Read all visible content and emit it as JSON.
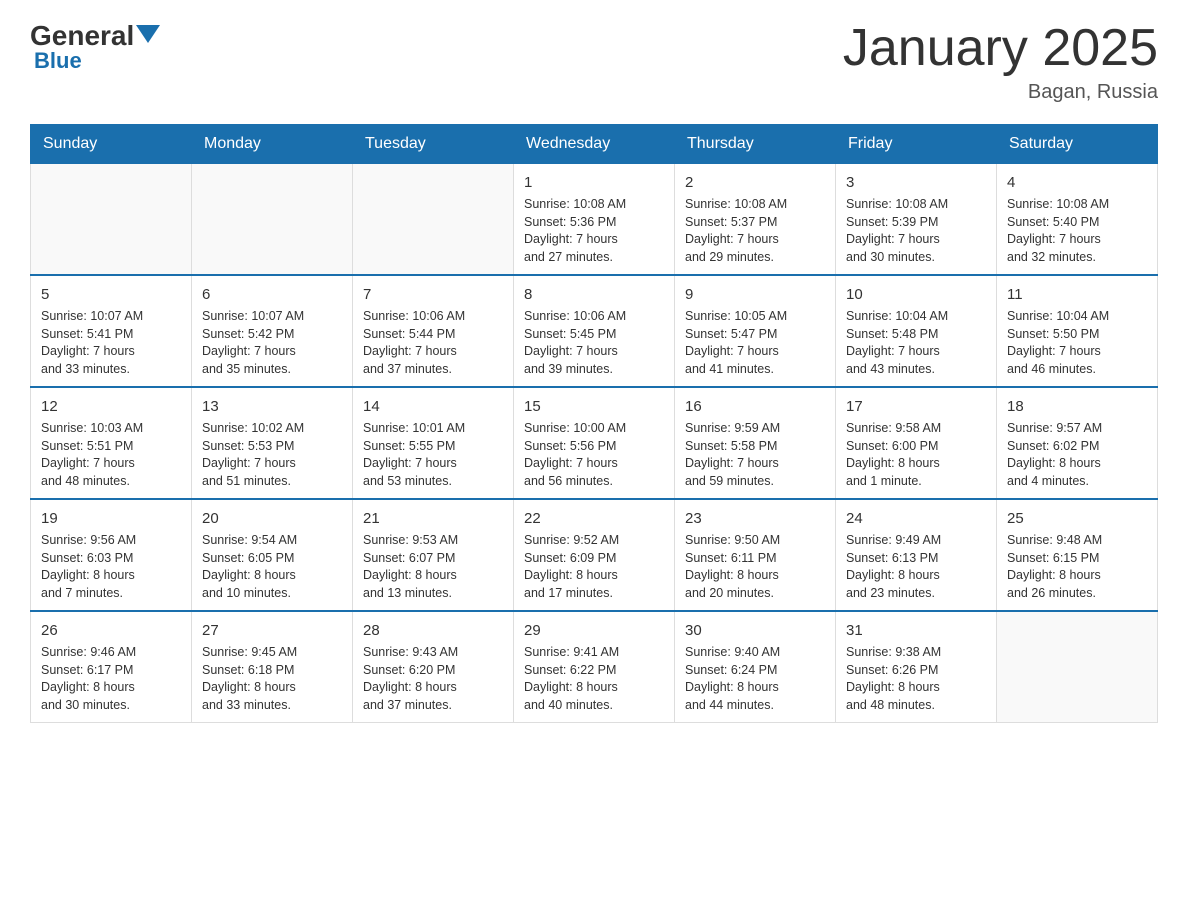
{
  "header": {
    "logo": {
      "general": "General",
      "blue": "Blue",
      "tagline": "Blue"
    },
    "title": "January 2025",
    "location": "Bagan, Russia"
  },
  "days_of_week": [
    "Sunday",
    "Monday",
    "Tuesday",
    "Wednesday",
    "Thursday",
    "Friday",
    "Saturday"
  ],
  "weeks": [
    [
      {
        "date": "",
        "info": ""
      },
      {
        "date": "",
        "info": ""
      },
      {
        "date": "",
        "info": ""
      },
      {
        "date": "1",
        "info": "Sunrise: 10:08 AM\nSunset: 5:36 PM\nDaylight: 7 hours\nand 27 minutes."
      },
      {
        "date": "2",
        "info": "Sunrise: 10:08 AM\nSunset: 5:37 PM\nDaylight: 7 hours\nand 29 minutes."
      },
      {
        "date": "3",
        "info": "Sunrise: 10:08 AM\nSunset: 5:39 PM\nDaylight: 7 hours\nand 30 minutes."
      },
      {
        "date": "4",
        "info": "Sunrise: 10:08 AM\nSunset: 5:40 PM\nDaylight: 7 hours\nand 32 minutes."
      }
    ],
    [
      {
        "date": "5",
        "info": "Sunrise: 10:07 AM\nSunset: 5:41 PM\nDaylight: 7 hours\nand 33 minutes."
      },
      {
        "date": "6",
        "info": "Sunrise: 10:07 AM\nSunset: 5:42 PM\nDaylight: 7 hours\nand 35 minutes."
      },
      {
        "date": "7",
        "info": "Sunrise: 10:06 AM\nSunset: 5:44 PM\nDaylight: 7 hours\nand 37 minutes."
      },
      {
        "date": "8",
        "info": "Sunrise: 10:06 AM\nSunset: 5:45 PM\nDaylight: 7 hours\nand 39 minutes."
      },
      {
        "date": "9",
        "info": "Sunrise: 10:05 AM\nSunset: 5:47 PM\nDaylight: 7 hours\nand 41 minutes."
      },
      {
        "date": "10",
        "info": "Sunrise: 10:04 AM\nSunset: 5:48 PM\nDaylight: 7 hours\nand 43 minutes."
      },
      {
        "date": "11",
        "info": "Sunrise: 10:04 AM\nSunset: 5:50 PM\nDaylight: 7 hours\nand 46 minutes."
      }
    ],
    [
      {
        "date": "12",
        "info": "Sunrise: 10:03 AM\nSunset: 5:51 PM\nDaylight: 7 hours\nand 48 minutes."
      },
      {
        "date": "13",
        "info": "Sunrise: 10:02 AM\nSunset: 5:53 PM\nDaylight: 7 hours\nand 51 minutes."
      },
      {
        "date": "14",
        "info": "Sunrise: 10:01 AM\nSunset: 5:55 PM\nDaylight: 7 hours\nand 53 minutes."
      },
      {
        "date": "15",
        "info": "Sunrise: 10:00 AM\nSunset: 5:56 PM\nDaylight: 7 hours\nand 56 minutes."
      },
      {
        "date": "16",
        "info": "Sunrise: 9:59 AM\nSunset: 5:58 PM\nDaylight: 7 hours\nand 59 minutes."
      },
      {
        "date": "17",
        "info": "Sunrise: 9:58 AM\nSunset: 6:00 PM\nDaylight: 8 hours\nand 1 minute."
      },
      {
        "date": "18",
        "info": "Sunrise: 9:57 AM\nSunset: 6:02 PM\nDaylight: 8 hours\nand 4 minutes."
      }
    ],
    [
      {
        "date": "19",
        "info": "Sunrise: 9:56 AM\nSunset: 6:03 PM\nDaylight: 8 hours\nand 7 minutes."
      },
      {
        "date": "20",
        "info": "Sunrise: 9:54 AM\nSunset: 6:05 PM\nDaylight: 8 hours\nand 10 minutes."
      },
      {
        "date": "21",
        "info": "Sunrise: 9:53 AM\nSunset: 6:07 PM\nDaylight: 8 hours\nand 13 minutes."
      },
      {
        "date": "22",
        "info": "Sunrise: 9:52 AM\nSunset: 6:09 PM\nDaylight: 8 hours\nand 17 minutes."
      },
      {
        "date": "23",
        "info": "Sunrise: 9:50 AM\nSunset: 6:11 PM\nDaylight: 8 hours\nand 20 minutes."
      },
      {
        "date": "24",
        "info": "Sunrise: 9:49 AM\nSunset: 6:13 PM\nDaylight: 8 hours\nand 23 minutes."
      },
      {
        "date": "25",
        "info": "Sunrise: 9:48 AM\nSunset: 6:15 PM\nDaylight: 8 hours\nand 26 minutes."
      }
    ],
    [
      {
        "date": "26",
        "info": "Sunrise: 9:46 AM\nSunset: 6:17 PM\nDaylight: 8 hours\nand 30 minutes."
      },
      {
        "date": "27",
        "info": "Sunrise: 9:45 AM\nSunset: 6:18 PM\nDaylight: 8 hours\nand 33 minutes."
      },
      {
        "date": "28",
        "info": "Sunrise: 9:43 AM\nSunset: 6:20 PM\nDaylight: 8 hours\nand 37 minutes."
      },
      {
        "date": "29",
        "info": "Sunrise: 9:41 AM\nSunset: 6:22 PM\nDaylight: 8 hours\nand 40 minutes."
      },
      {
        "date": "30",
        "info": "Sunrise: 9:40 AM\nSunset: 6:24 PM\nDaylight: 8 hours\nand 44 minutes."
      },
      {
        "date": "31",
        "info": "Sunrise: 9:38 AM\nSunset: 6:26 PM\nDaylight: 8 hours\nand 48 minutes."
      },
      {
        "date": "",
        "info": ""
      }
    ]
  ]
}
